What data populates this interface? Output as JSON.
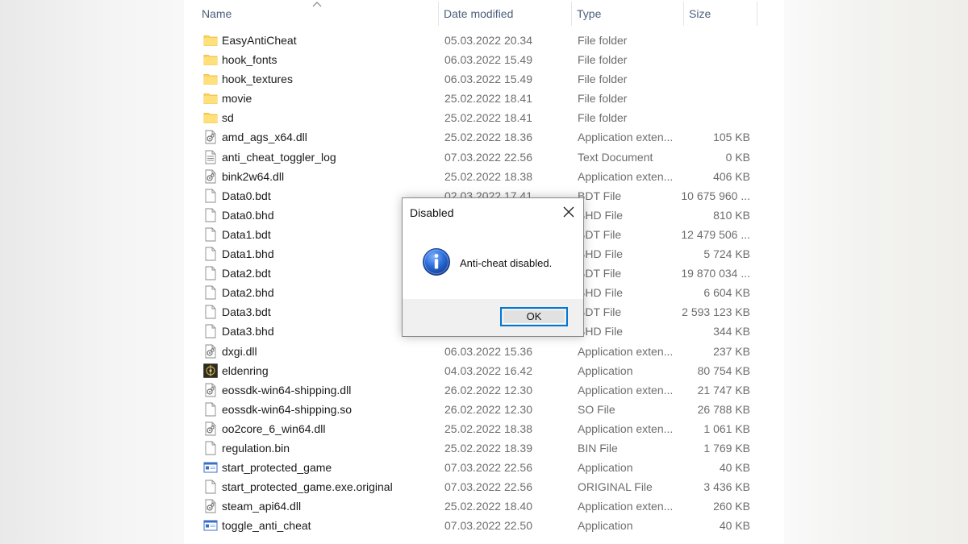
{
  "columns": {
    "name": "Name",
    "date": "Date modified",
    "type": "Type",
    "size": "Size"
  },
  "files": [
    {
      "name": "EasyAntiCheat",
      "date": "05.03.2022 20.34",
      "type": "File folder",
      "size": "",
      "icon": "folder-icon"
    },
    {
      "name": "hook_fonts",
      "date": "06.03.2022 15.49",
      "type": "File folder",
      "size": "",
      "icon": "folder-icon"
    },
    {
      "name": "hook_textures",
      "date": "06.03.2022 15.49",
      "type": "File folder",
      "size": "",
      "icon": "folder-icon"
    },
    {
      "name": "movie",
      "date": "25.02.2022 18.41",
      "type": "File folder",
      "size": "",
      "icon": "folder-icon"
    },
    {
      "name": "sd",
      "date": "25.02.2022 18.41",
      "type": "File folder",
      "size": "",
      "icon": "folder-icon"
    },
    {
      "name": "amd_ags_x64.dll",
      "date": "25.02.2022 18.36",
      "type": "Application exten...",
      "size": "105 KB",
      "icon": "dll-file-icon"
    },
    {
      "name": "anti_cheat_toggler_log",
      "date": "07.03.2022 22.56",
      "type": "Text Document",
      "size": "0 KB",
      "icon": "text-file-icon"
    },
    {
      "name": "bink2w64.dll",
      "date": "25.02.2022 18.38",
      "type": "Application exten...",
      "size": "406 KB",
      "icon": "dll-file-icon"
    },
    {
      "name": "Data0.bdt",
      "date": "02.03.2022 17.41",
      "type": "BDT File",
      "size": "10 675 960 ...",
      "icon": "blank-file-icon"
    },
    {
      "name": "Data0.bhd",
      "date": "",
      "type": "BHD File",
      "size": "810 KB",
      "icon": "blank-file-icon"
    },
    {
      "name": "Data1.bdt",
      "date": "",
      "type": "BDT File",
      "size": "12 479 506 ...",
      "icon": "blank-file-icon"
    },
    {
      "name": "Data1.bhd",
      "date": "",
      "type": "BHD File",
      "size": "5 724 KB",
      "icon": "blank-file-icon"
    },
    {
      "name": "Data2.bdt",
      "date": "",
      "type": "BDT File",
      "size": "19 870 034 ...",
      "icon": "blank-file-icon"
    },
    {
      "name": "Data2.bhd",
      "date": "",
      "type": "BHD File",
      "size": "6 604 KB",
      "icon": "blank-file-icon"
    },
    {
      "name": "Data3.bdt",
      "date": "",
      "type": "BDT File",
      "size": "2 593 123 KB",
      "icon": "blank-file-icon"
    },
    {
      "name": "Data3.bhd",
      "date": "",
      "type": "BHD File",
      "size": "344 KB",
      "icon": "blank-file-icon"
    },
    {
      "name": "dxgi.dll",
      "date": "06.03.2022 15.36",
      "type": "Application exten...",
      "size": "237 KB",
      "icon": "dll-file-icon"
    },
    {
      "name": "eldenring",
      "date": "04.03.2022 16.42",
      "type": "Application",
      "size": "80 754 KB",
      "icon": "eldenring-app-icon"
    },
    {
      "name": "eossdk-win64-shipping.dll",
      "date": "26.02.2022 12.30",
      "type": "Application exten...",
      "size": "21 747 KB",
      "icon": "dll-file-icon"
    },
    {
      "name": "eossdk-win64-shipping.so",
      "date": "26.02.2022 12.30",
      "type": "SO File",
      "size": "26 788 KB",
      "icon": "blank-file-icon"
    },
    {
      "name": "oo2core_6_win64.dll",
      "date": "25.02.2022 18.38",
      "type": "Application exten...",
      "size": "1 061 KB",
      "icon": "dll-file-icon"
    },
    {
      "name": "regulation.bin",
      "date": "25.02.2022 18.39",
      "type": "BIN File",
      "size": "1 769 KB",
      "icon": "blank-file-icon"
    },
    {
      "name": "start_protected_game",
      "date": "07.03.2022 22.56",
      "type": "Application",
      "size": "40 KB",
      "icon": "exe-app-icon"
    },
    {
      "name": "start_protected_game.exe.original",
      "date": "07.03.2022 22.56",
      "type": "ORIGINAL File",
      "size": "3 436 KB",
      "icon": "blank-file-icon"
    },
    {
      "name": "steam_api64.dll",
      "date": "25.02.2022 18.40",
      "type": "Application exten...",
      "size": "260 KB",
      "icon": "dll-file-icon"
    },
    {
      "name": "toggle_anti_cheat",
      "date": "07.03.2022 22.50",
      "type": "Application",
      "size": "40 KB",
      "icon": "exe-app-icon"
    }
  ],
  "dialog": {
    "title": "Disabled",
    "message": "Anti-cheat disabled.",
    "ok_label": "OK",
    "icon": "info-icon"
  },
  "colors": {
    "header_text": "#4c607a",
    "folder": "#ffd35b",
    "accent": "#0078d7",
    "info_blue": "#1f5fbf"
  }
}
